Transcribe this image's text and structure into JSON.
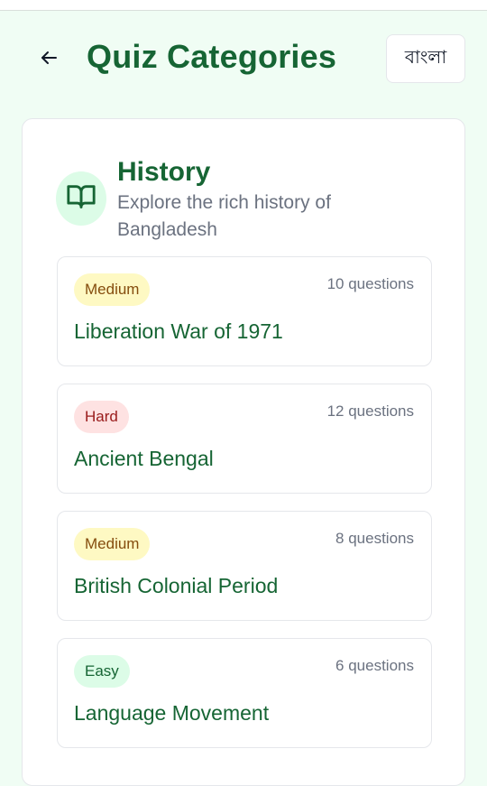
{
  "header": {
    "title": "Quiz Categories",
    "back_icon": "arrow-left-icon",
    "language_button": "বাংলা"
  },
  "category": {
    "icon": "book-open-icon",
    "title": "History",
    "description": "Explore the rich history of Bangladesh"
  },
  "quizzes": [
    {
      "difficulty": "Medium",
      "questions": "10 questions",
      "title": "Liberation War of 1971"
    },
    {
      "difficulty": "Hard",
      "questions": "12 questions",
      "title": "Ancient Bengal"
    },
    {
      "difficulty": "Medium",
      "questions": "8 questions",
      "title": "British Colonial Period"
    },
    {
      "difficulty": "Easy",
      "questions": "6 questions",
      "title": "Language Movement"
    }
  ],
  "colors": {
    "background": "#f0fdf4",
    "accent": "#166534",
    "medium_badge": "#fef9c3",
    "hard_badge": "#fee2e2",
    "easy_badge": "#dcfce7"
  }
}
